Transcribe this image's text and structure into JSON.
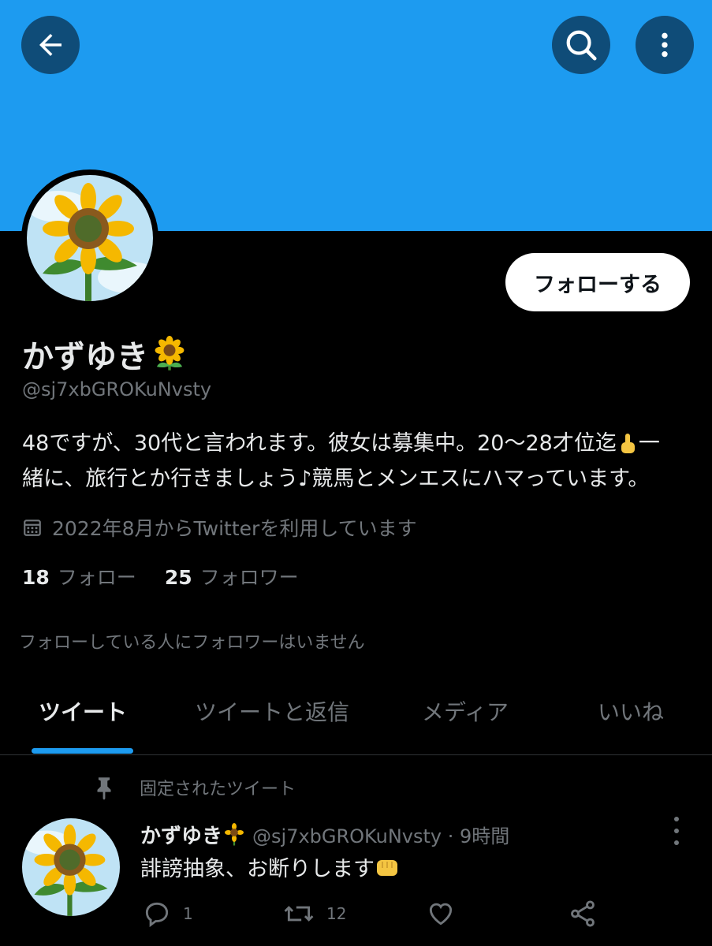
{
  "header": {
    "back_icon": "arrow-left-icon",
    "search_icon": "search-icon",
    "more_icon": "more-vertical-icon",
    "banner_color": "#1d9bf0"
  },
  "profile": {
    "avatar_icon": "sunflower-avatar",
    "follow_label": "フォローする",
    "display_name": "かずゆき",
    "display_name_emoji": "sunflower-emoji",
    "handle": "@sj7xbGROKuNvsty",
    "bio_line1": "48ですが、30代と言われます。彼女は募集中。20〜28才位迄",
    "bio_line1_emoji": "pointing-up-emoji",
    "bio_line1_end": "一",
    "bio_line2": "緒に、旅行とか行きましょう♪競馬とメンエスにハマっています。",
    "joined": "2022年8月からTwitterを利用しています",
    "following_count": "18",
    "following_label": "フォロー",
    "followers_count": "25",
    "followers_label": "フォロワー",
    "no_mutual": "フォローしている人にフォロワーはいません"
  },
  "tabs": [
    {
      "label": "ツイート",
      "active": true
    },
    {
      "label": "ツイートと返信",
      "active": false
    },
    {
      "label": "メディア",
      "active": false
    },
    {
      "label": "いいね",
      "active": false
    }
  ],
  "pinned_tweet": {
    "pinned_label": "固定されたツイート",
    "author_name": "かずゆき",
    "handle_time": "@sj7xbGROKuNvsty · 9時間",
    "text": "誹謗抽象、お断りします",
    "text_emoji": "fist-emoji",
    "reply_count": "1",
    "retweet_count": "12",
    "like_count": "",
    "icons": [
      "reply-icon",
      "retweet-icon",
      "like-icon",
      "share-icon"
    ]
  }
}
